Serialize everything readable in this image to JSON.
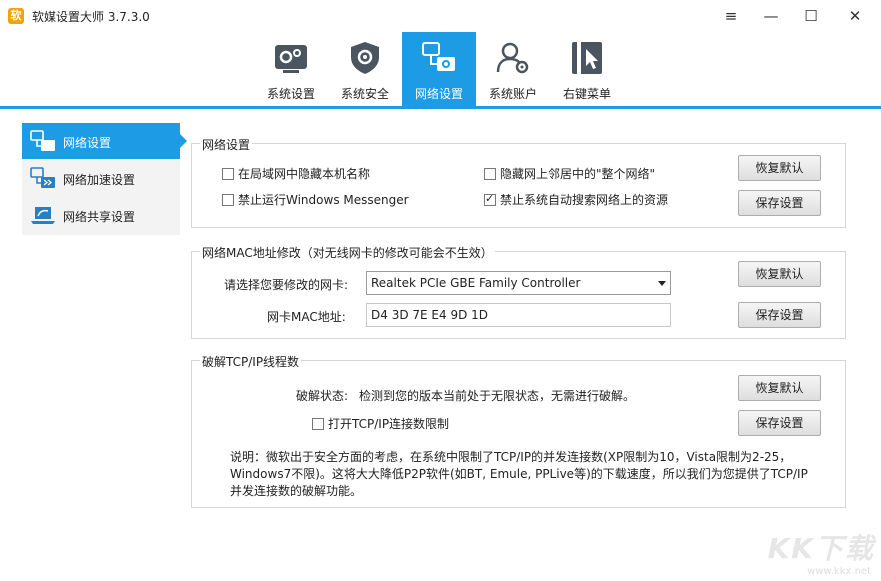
{
  "window": {
    "title": "软媒设置大师 3.7.3.0",
    "icon_glyph": "软",
    "menu_icon": "≡",
    "minimize_icon": "—",
    "maximize_icon": "☐",
    "close_icon": "✕"
  },
  "toolbar": {
    "tabs": [
      {
        "label": "系统设置"
      },
      {
        "label": "系统安全"
      },
      {
        "label": "网络设置"
      },
      {
        "label": "系统账户"
      },
      {
        "label": "右键菜单"
      }
    ],
    "active_index": 2
  },
  "sidebar": {
    "items": [
      {
        "label": "网络设置"
      },
      {
        "label": "网络加速设置"
      },
      {
        "label": "网络共享设置"
      }
    ]
  },
  "network_group": {
    "title": "网络设置",
    "options": [
      {
        "label": "在局域网中隐藏本机名称",
        "checked": false
      },
      {
        "label": "隐藏网上邻居中的\"整个网络\"",
        "checked": false
      },
      {
        "label": "禁止运行Windows Messenger",
        "checked": false
      },
      {
        "label": "禁止系统自动搜索网络上的资源",
        "checked": true
      }
    ],
    "restore_label": "恢复默认",
    "save_label": "保存设置"
  },
  "mac_group": {
    "title": "网络MAC地址修改（对无线网卡的修改可能会不生效）",
    "adapter_label": "请选择您要修改的网卡:",
    "adapter_value": "Realtek PCIe GBE Family Controller",
    "mac_label": "网卡MAC地址:",
    "mac_value": "D4 3D 7E E4 9D 1D",
    "restore_label": "恢复默认",
    "save_label": "保存设置"
  },
  "tcp_group": {
    "title": "破解TCP/IP线程数",
    "status_label": "破解状态:",
    "status_value": "检测到您的版本当前处于无限状态，无需进行破解。",
    "option_label": "打开TCP/IP连接数限制",
    "option_checked": false,
    "restore_label": "恢复默认",
    "save_label": "保存设置",
    "desc_lines": [
      "说明：微软出于安全方面的考虑，在系统中限制了TCP/IP的并发连接数(XP限制为10，Vista限制为2-25，",
      "Windows7不限)。这将大大降低P2P软件(如BT, Emule, PPLive等)的下载速度，所以我们为您提供了TCP/IP",
      "并发连接数的破解功能。"
    ]
  },
  "watermark": {
    "text": "KK下载",
    "url": "www.kkx.net"
  },
  "colors": {
    "accent": "#1e9be5",
    "sidebar_bg": "#f3f3f3",
    "icon_dark": "#4a5560"
  }
}
